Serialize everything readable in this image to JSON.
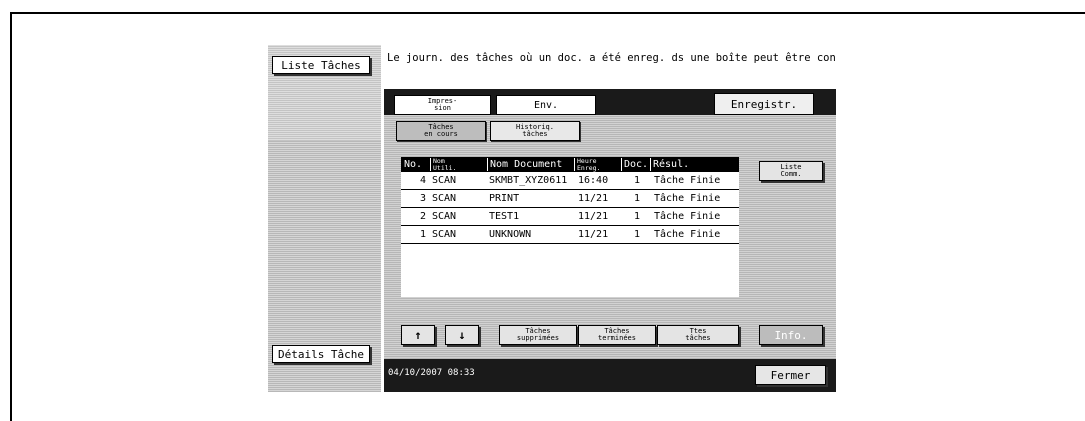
{
  "left": {
    "jobs_list": "Liste Tâches",
    "job_details": "Détails Tâche"
  },
  "message": "Le journ. des tâches où un doc. a été enreg. ds une boîte peut être consulté.",
  "tabs": [
    {
      "label": "Impres-\nsion"
    },
    {
      "label": "Env."
    },
    {
      "label": "Enregistr."
    }
  ],
  "subtabs": [
    {
      "label": "Tâches\nen cours"
    },
    {
      "label": "Historiq.\ntâches"
    }
  ],
  "table": {
    "headers": [
      "No.",
      "Nom\nUtili.",
      "Nom Document",
      "Heure\nEnreg.",
      "Doc.",
      "Résul."
    ],
    "rows": [
      {
        "no": "4",
        "user": "SCAN",
        "doc": "SKMBT_XYZ0611",
        "time": "16:40",
        "count": "1",
        "result": "Tâche Finie"
      },
      {
        "no": "3",
        "user": "SCAN",
        "doc": "PRINT",
        "time": "11/21",
        "count": "1",
        "result": "Tâche Finie"
      },
      {
        "no": "2",
        "user": "SCAN",
        "doc": "TEST1",
        "time": "11/21",
        "count": "1",
        "result": "Tâche Finie"
      },
      {
        "no": "1",
        "user": "SCAN",
        "doc": "UNKNOWN",
        "time": "11/21",
        "count": "1",
        "result": "Tâche Finie"
      }
    ]
  },
  "side": {
    "comm_list": "Liste\nComm.",
    "info": "Info."
  },
  "bottom": {
    "up_arrow": "↑",
    "down_arrow": "↓",
    "deleted_jobs": "Tâches\nsupprimées",
    "finished_jobs": "Tâches\nterminées",
    "all_jobs": "Ttes\ntâches",
    "datetime": "04/10/2007   08:33",
    "close": "Fermer"
  }
}
